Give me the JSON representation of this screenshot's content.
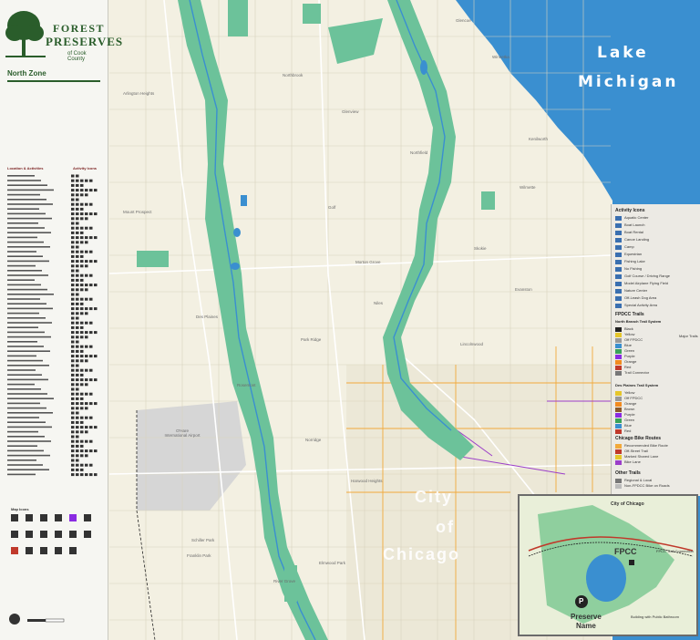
{
  "logo": {
    "line1": "FOREST",
    "line2": "PRESERVES",
    "line3": "of Cook County"
  },
  "zone": "North Zone",
  "lake": {
    "word1": "Lake",
    "word2": "Michigan",
    "color": "#3a8fd0"
  },
  "city": {
    "word1": "City",
    "word2": "of",
    "word3": "Chicago"
  },
  "airport": "O'Hare International Airport",
  "preserve_color": "#6cc29a",
  "water_color": "#3a8fd0",
  "left_panel": {
    "list_header_left": "Location & Activities",
    "list_header_right": "Activity Icons",
    "map_icons_title": "Map Icons"
  },
  "legend": {
    "activity_title": "Activity Icons",
    "activities": [
      "Aquatic Center",
      "Boat Launch",
      "Boat Rental",
      "Canoe Landing",
      "Camp",
      "Equestrian",
      "Fishing Lake",
      "No Fishing",
      "Golf Course / Driving Range",
      "Model Airplane Flying Field",
      "Nature Center",
      "Off-Leash Dog Area",
      "Special Activity Area"
    ],
    "trails_title": "FPDCC Trails",
    "north_branch_title": "North Branch Trail System",
    "north_branch_items": [
      "Black",
      "Yellow",
      "Off FPDCC",
      "Blue",
      "Green",
      "Purple",
      "Orange",
      "Red",
      "Trail Connector"
    ],
    "major_trails": "Major Trails",
    "desplaines_title": "Des Plaines Trail System",
    "desplaines_items": [
      "Yellow",
      "Off FPDCC",
      "Orange",
      "Brown",
      "Purple",
      "Green",
      "Blue",
      "Red"
    ],
    "bike_title": "Chicago Bike Routes",
    "bike_items": [
      "Recommended Bike Route",
      "Off-Street Trail",
      "Marked Shared Lane",
      "Bike Lane"
    ],
    "other_title": "Other Trails",
    "other_items": [
      "Regional & Local",
      "Non-FPDCC Bike on Roads"
    ]
  },
  "inset": {
    "label_fpcc": "FPCC",
    "label_preserve": "Preserve",
    "label_name": "Name",
    "label_city": "City of Chicago",
    "label_connector": "FPCC Trail Connection",
    "label_building": "Building with Public Bathroom",
    "label_parking": "P"
  },
  "towns": [
    "Northbrook",
    "Glenview",
    "Northfield",
    "Wilmette",
    "Evanston",
    "Skokie",
    "Niles",
    "Morton Grove",
    "Park Ridge",
    "Des Plaines",
    "Mount Prospect",
    "Arlington Heights",
    "Franklin Park",
    "Elmwood Park",
    "Harwood Heights",
    "Lincolnwood",
    "Winnetka",
    "Glencoe",
    "Kenilworth",
    "Golf",
    "Schiller Park",
    "Rosemont",
    "Norridge",
    "River Grove"
  ]
}
